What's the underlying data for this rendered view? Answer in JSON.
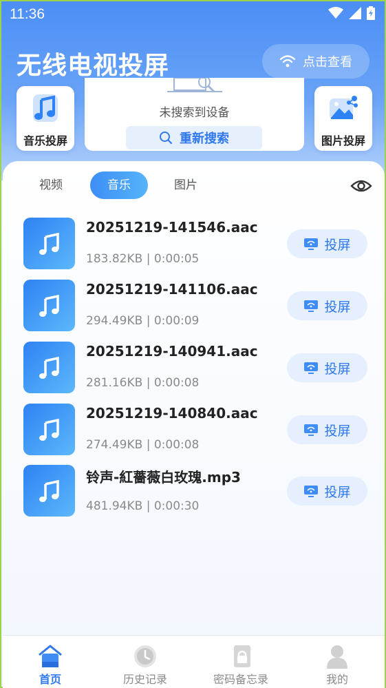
{
  "status_bar": {
    "time": "11:36"
  },
  "header": {
    "title": "无线电视投屏",
    "check_label": "点击查看"
  },
  "tiles": {
    "music_label": "音乐投屏",
    "image_label": "图片投屏"
  },
  "search": {
    "status_text": "未搜索到设备",
    "rescan_label": "重新搜索"
  },
  "tabs": [
    {
      "label": "视频",
      "active": false
    },
    {
      "label": "音乐",
      "active": true
    },
    {
      "label": "图片",
      "active": false
    }
  ],
  "files": [
    {
      "name": "20251219-141546.aac",
      "size": "183.82KB",
      "duration": "0:00:05",
      "meta": "183.82KB  |  0:00:05",
      "cast_label": "投屏"
    },
    {
      "name": "20251219-141106.aac",
      "size": "294.49KB",
      "duration": "0:00:09",
      "meta": "294.49KB  |  0:00:09",
      "cast_label": "投屏"
    },
    {
      "name": "20251219-140941.aac",
      "size": "281.16KB",
      "duration": "0:00:08",
      "meta": "281.16KB  |  0:00:08",
      "cast_label": "投屏"
    },
    {
      "name": "20251219-140840.aac",
      "size": "274.49KB",
      "duration": "0:00:08",
      "meta": "274.49KB  |  0:00:08",
      "cast_label": "投屏"
    },
    {
      "name": "铃声-紅薔薇白玫瑰.mp3",
      "size": "481.94KB",
      "duration": "0:00:30",
      "meta": "481.94KB  |  0:00:30",
      "cast_label": "投屏"
    }
  ],
  "bottom_nav": [
    {
      "label": "首页",
      "icon": "home-icon",
      "active": true
    },
    {
      "label": "历史记录",
      "icon": "history-icon",
      "active": false
    },
    {
      "label": "密码备忘录",
      "icon": "lock-icon",
      "active": false
    },
    {
      "label": "我的",
      "icon": "user-icon",
      "active": false
    }
  ],
  "colors": {
    "accent": "#2f78ee",
    "header_blue": "#4b8ef5",
    "frame_green": "#9bd34a"
  }
}
